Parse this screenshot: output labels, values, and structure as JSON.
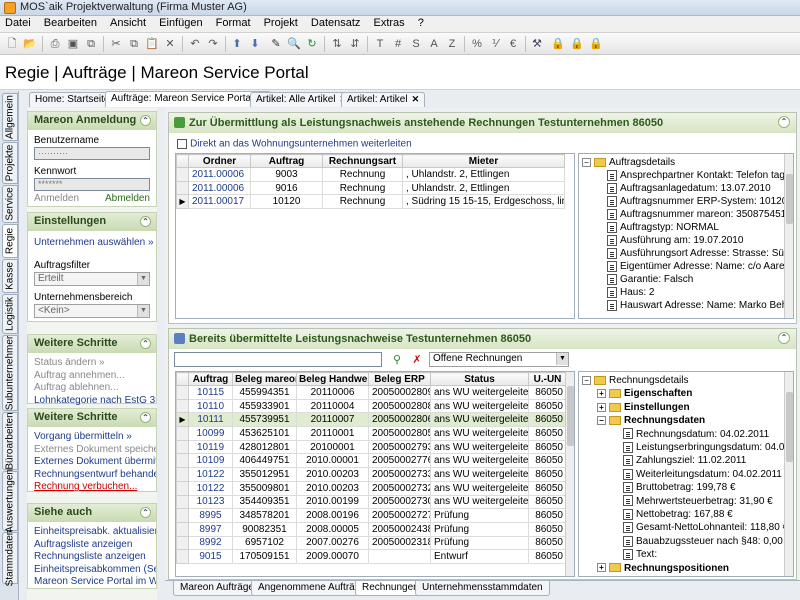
{
  "window": {
    "title": "MOS`aik Projektverwaltung (Firma Muster AG)"
  },
  "menu": [
    "Datei",
    "Bearbeiten",
    "Ansicht",
    "Einfügen",
    "Format",
    "Projekt",
    "Datensatz",
    "Extras",
    "?"
  ],
  "toolbar_glyphs": {
    "bold": "T",
    "hash": "#",
    "s": "S",
    "a": "A",
    "z": "Z",
    "percent": "%"
  },
  "page_title": "Regie | Aufträge | Mareon Service Portal",
  "doc_tabs": [
    "Home: Startseite",
    "Aufträge: Mareon Service Portal",
    "Artikel: Alle Artikel",
    "Artikel: Artikel"
  ],
  "vertical_tabs": [
    "Allgemein",
    "Projekte",
    "Service",
    "Regie",
    "Kasse",
    "Logistik",
    "Subunternehmer",
    "Büroarbeiten",
    "Auswertungen",
    "Stammdaten"
  ],
  "sidebar": {
    "login": {
      "title": "Mareon Anmeldung",
      "user_label": "Benutzername",
      "user_value": "··········",
      "pass_label": "Kennwort",
      "pass_value": "*******",
      "anmelden": "Anmelden",
      "abmelden": "Abmelden"
    },
    "settings": {
      "title": "Einstellungen",
      "choose_company": "Unternehmen auswählen »",
      "filter_label": "Auftragsfilter",
      "filter_value": "Erteilt",
      "area_label": "Unternehmensbereich",
      "area_value": "<Kein>"
    },
    "steps1": {
      "title": "Weitere Schritte",
      "items": [
        "Status ändern »",
        "Auftrag annehmen...",
        "Auftrag ablehnen...",
        "Lohnkategorie nach EstG 35a »"
      ]
    },
    "steps2": {
      "title": "Weitere Schritte",
      "items": [
        "Vorgang übermitteln »",
        "Externes Dokument speichern",
        "Externes Dokument übermitteln",
        "Rechnungsentwurf behandeln »",
        "Rechnung verbuchen..."
      ]
    },
    "see_also": {
      "title": "Siehe auch",
      "items": [
        "Einheitspreisabk. aktualisieren",
        "Auftragsliste anzeigen",
        "Rechnungsliste anzeigen",
        "Einheitspreisabkommen (Sets)",
        "Mareon Service Portal im Web"
      ]
    }
  },
  "section1": {
    "title": "Zur Übermittlung als Leistungsnachweis anstehende Rechnungen Testunternehmen 86050",
    "checkbox_label": "Direkt an das Wohnungsunternehmen weiterleiten",
    "columns": [
      "Ordner",
      "Auftrag",
      "Rechnungsart",
      "Mieter"
    ],
    "rows": [
      [
        "2011.00006",
        "9003",
        "Rechnung",
        ", Uhlandstr. 2, Ettlingen"
      ],
      [
        "2011.00006",
        "9016",
        "Rechnung",
        ", Uhlandstr. 2, Ettlingen"
      ],
      [
        "2011.00017",
        "10120",
        "Rechnung",
        ", Südring 15 15-15, Erdgeschoss, links,..."
      ]
    ],
    "tree_root": "Auftragsdetails",
    "tree_items": [
      "Ansprechpartner Kontakt: Telefon tags",
      "Auftragsanlagedatum: 13.07.2010",
      "Auftragsnummer ERP-System: 10120",
      "Auftragsnummer mareon: 350875451",
      "Auftragstyp: NORMAL",
      "Ausführung am: 19.07.2010",
      "Ausführungsort Adresse: Strasse: Südr",
      "Eigentümer Adresse: Name: c/o Aareon",
      "Garantie: Falsch",
      "Haus: 2",
      "Hauswart Adresse: Name: Marko Behre"
    ]
  },
  "section2": {
    "title": "Bereits übermittelte Leistungsnachweise Testunternehmen 86050",
    "filter_value": "Offene Rechnungen",
    "columns": [
      "Auftrag",
      "Beleg mareon",
      "Beleg Handwerker",
      "Beleg ERP",
      "Status",
      "U.-UN"
    ],
    "rows": [
      [
        "10115",
        "455994351",
        "20110006",
        "20050002809",
        "ans WU weitergeleitet",
        "86050"
      ],
      [
        "10110",
        "455933901",
        "20110004",
        "20050002808",
        "ans WU weitergeleitet",
        "86050"
      ],
      [
        "10111",
        "455739951",
        "20110007",
        "20050002806",
        "ans WU weitergeleitet",
        "86050"
      ],
      [
        "10099",
        "453625101",
        "20110001",
        "20050002805",
        "ans WU weitergeleitet",
        "86050"
      ],
      [
        "10119",
        "428012801",
        "20100001",
        "20050002793",
        "ans WU weitergeleitet",
        "86050"
      ],
      [
        "10109",
        "406449751",
        "2010.00001",
        "20050002776",
        "ans WU weitergeleitet",
        "86050"
      ],
      [
        "10122",
        "355012951",
        "2010.00203",
        "20050002733",
        "ans WU weitergeleitet",
        "86050"
      ],
      [
        "10122",
        "355009801",
        "2010.00203",
        "20050002732",
        "ans WU weitergeleitet",
        "86050"
      ],
      [
        "10123",
        "354409351",
        "2010.00199",
        "20050002730",
        "ans WU weitergeleitet",
        "86050"
      ],
      [
        "8995",
        "348578201",
        "2008.00196",
        "20050002727",
        "Prüfung",
        "86050"
      ],
      [
        "8997",
        "90082351",
        "2008.00005",
        "20050002438",
        "Prüfung",
        "86050"
      ],
      [
        "8992",
        "6957102",
        "2007.00276",
        "20050002318",
        "Prüfung",
        "86050"
      ],
      [
        "9015",
        "170509151",
        "2009.00070",
        "",
        "Entwurf",
        "86050"
      ]
    ],
    "tree": [
      {
        "label": "Rechnungsdetails",
        "kind": "root"
      },
      {
        "label": "Eigenschaften",
        "kind": "folder"
      },
      {
        "label": "Einstellungen",
        "kind": "folder"
      },
      {
        "label": "Rechnungsdaten",
        "kind": "folder-open"
      },
      {
        "label": "Rechnungsdatum: 04.02.2011",
        "kind": "doc"
      },
      {
        "label": "Leistungserbringungsdatum: 04.02.20",
        "kind": "doc"
      },
      {
        "label": "Zahlungsziel: 11.02.2011",
        "kind": "doc"
      },
      {
        "label": "Weiterleitungsdatum: 04.02.2011",
        "kind": "doc"
      },
      {
        "label": "Bruttobetrag: 199,78 €",
        "kind": "doc"
      },
      {
        "label": "Mehrwertsteuerbetrag: 31,90 €",
        "kind": "doc"
      },
      {
        "label": "Nettobetrag: 167,88 €",
        "kind": "doc"
      },
      {
        "label": "Gesamt-NettoLohnanteil: 118,80 €",
        "kind": "doc"
      },
      {
        "label": "Bauabzugssteuer nach §48: 0,00 %",
        "kind": "doc"
      },
      {
        "label": "Text:",
        "kind": "doc"
      },
      {
        "label": "Rechnungspositionen",
        "kind": "folder"
      }
    ]
  },
  "bottom_tabs": [
    "Mareon Aufträge",
    "Angenommene Aufträge",
    "Rechnungen",
    "Unternehmensstammdaten"
  ]
}
